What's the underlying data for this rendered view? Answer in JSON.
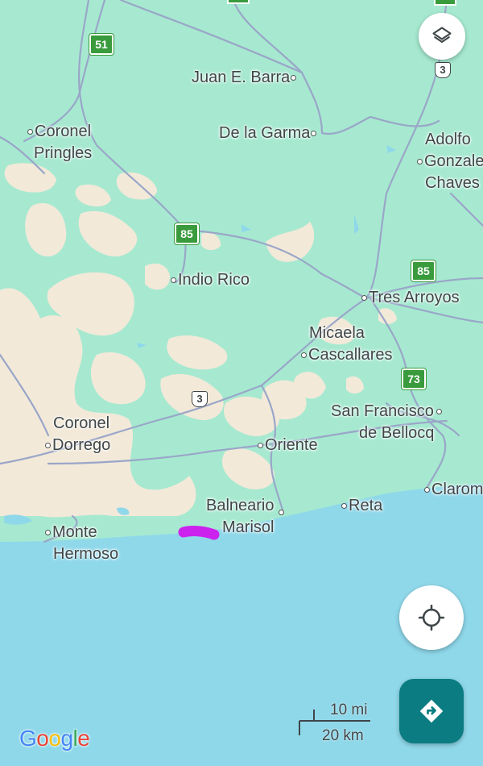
{
  "colors": {
    "land": "#a6e9d0",
    "urban_sand": "#f2e9d9",
    "sea": "#8fd8ea",
    "road": "#9aa6c8",
    "route_highlight": "#cc22ee",
    "shield_provincial": "#3a9b3d",
    "directions_button": "#0b7d82"
  },
  "places": [
    {
      "id": "juan-e-barra",
      "lines": [
        "Juan E. Barra"
      ],
      "dot": "right"
    },
    {
      "id": "coronel-pringles",
      "lines": [
        "Coronel",
        "Pringles"
      ],
      "dot": "left"
    },
    {
      "id": "de-la-garma",
      "lines": [
        "De la Garma"
      ],
      "dot": "right"
    },
    {
      "id": "adolfo-gonzales-chaves",
      "lines": [
        "Adolfo",
        "Gonzale",
        "Chaves"
      ],
      "dot": "left"
    },
    {
      "id": "indio-rico",
      "lines": [
        "Indio Rico"
      ],
      "dot": "left"
    },
    {
      "id": "tres-arroyos",
      "lines": [
        "Tres Arroyos"
      ],
      "dot": "left"
    },
    {
      "id": "micaela-cascallares",
      "lines": [
        "Micaela",
        "Cascallares"
      ],
      "dot": "left"
    },
    {
      "id": "san-francisco-de-bellocq",
      "lines": [
        "San Francisco",
        "de Bellocq"
      ],
      "dot": "right"
    },
    {
      "id": "coronel-dorrego",
      "lines": [
        "Coronel",
        "Dorrego"
      ],
      "dot": "left"
    },
    {
      "id": "oriente",
      "lines": [
        "Oriente"
      ],
      "dot": "left"
    },
    {
      "id": "balneario-marisol",
      "lines": [
        "Balneario",
        "Marisol"
      ],
      "dot": "right"
    },
    {
      "id": "reta",
      "lines": [
        "Reta"
      ],
      "dot": "left"
    },
    {
      "id": "claromeco",
      "lines": [
        "Clarom"
      ],
      "dot": "left"
    },
    {
      "id": "monte-hermoso",
      "lines": [
        "Monte",
        "Hermoso"
      ],
      "dot": "left"
    }
  ],
  "shields": [
    {
      "id": "route-51",
      "number": "51",
      "type": "provincial"
    },
    {
      "id": "route-85-west",
      "number": "85",
      "type": "provincial"
    },
    {
      "id": "route-85-east",
      "number": "85",
      "type": "provincial"
    },
    {
      "id": "route-73",
      "number": "73",
      "type": "provincial"
    },
    {
      "id": "route-3-north",
      "number": "3",
      "type": "national"
    },
    {
      "id": "route-3-south",
      "number": "3",
      "type": "national"
    }
  ],
  "scale_bar": {
    "top_label": "10 mi",
    "bottom_label": "20 km"
  },
  "logo": {
    "letters": [
      "G",
      "o",
      "o",
      "g",
      "l",
      "e"
    ],
    "colors": [
      "#4285f4",
      "#ea4335",
      "#fbbc05",
      "#4285f4",
      "#34a853",
      "#ea4335"
    ]
  },
  "icons": {
    "layers": "layers-icon",
    "locate": "my-location-icon",
    "directions": "directions-icon"
  }
}
